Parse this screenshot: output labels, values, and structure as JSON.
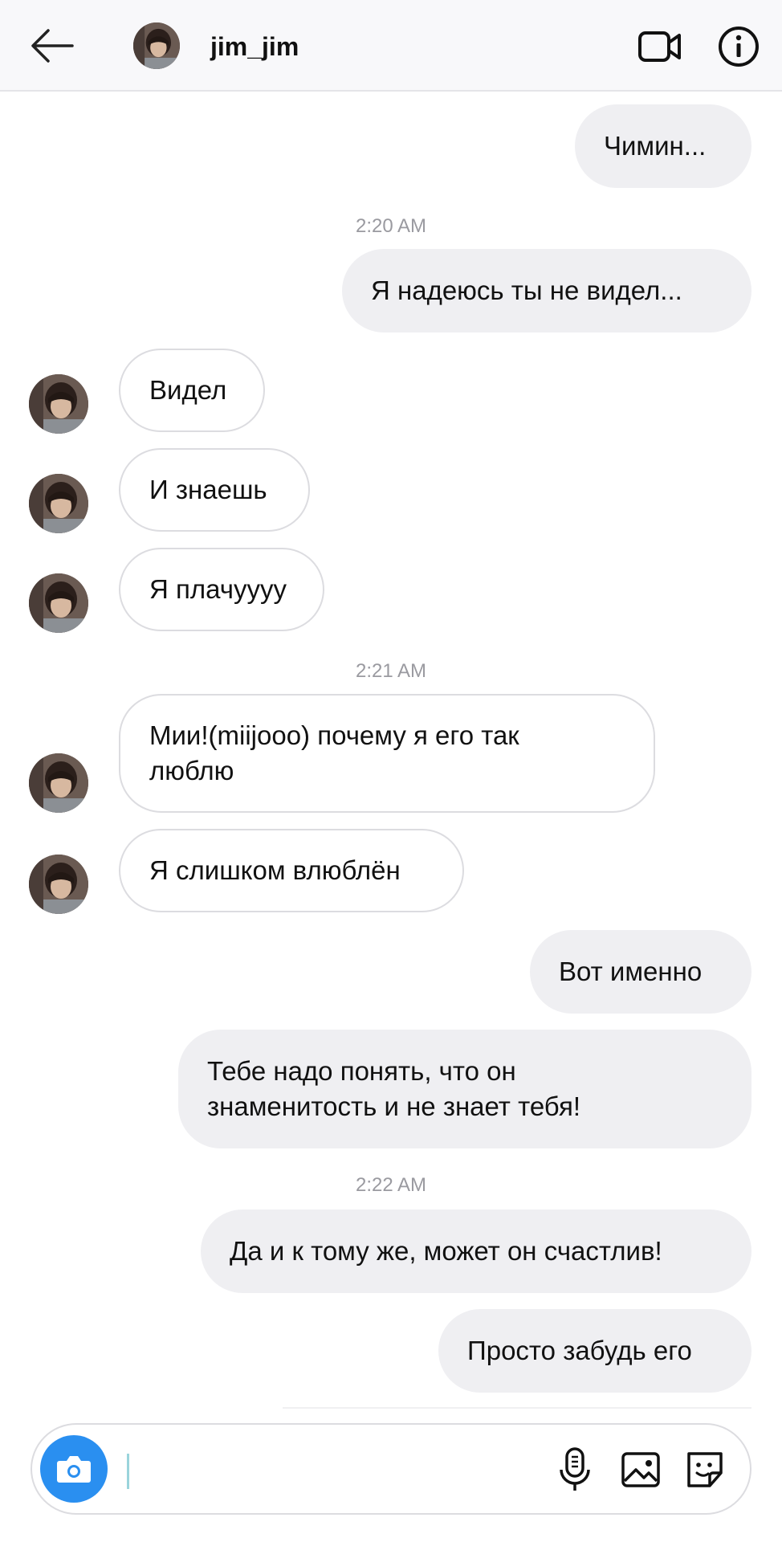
{
  "header": {
    "username": "jim_jim",
    "icons": {
      "back": "arrow-left-icon",
      "video": "video-camera-icon",
      "info": "info-icon"
    }
  },
  "timestamps": [
    "2:20 AM",
    "2:21 AM",
    "2:22 AM"
  ],
  "messages": [
    {
      "direction": "outgoing",
      "text": "Чимин..."
    },
    {
      "direction": "outgoing",
      "text": "Я надеюсь ты не видел..."
    },
    {
      "direction": "incoming",
      "text": "Видел"
    },
    {
      "direction": "incoming",
      "text": "И знаешь"
    },
    {
      "direction": "incoming",
      "text": "Я плачуууу"
    },
    {
      "direction": "incoming",
      "line1": "Мии!(miijooo) почему я его так",
      "line2": "люблю"
    },
    {
      "direction": "incoming",
      "text": "Я слишком влюблён"
    },
    {
      "direction": "outgoing",
      "text": "Вот именно"
    },
    {
      "direction": "outgoing",
      "line1": "Тебе надо понять, что он",
      "line2": "знаменитость и не знает тебя!"
    },
    {
      "direction": "outgoing",
      "text": "Да и к тому же, может он счастлив!"
    },
    {
      "direction": "outgoing",
      "text": "Просто забудь его"
    }
  ],
  "composer": {
    "placeholder": "",
    "icons": [
      "camera-icon",
      "microphone-icon",
      "gallery-icon",
      "sticker-icon"
    ]
  },
  "colors": {
    "accent": "#2a8ff0",
    "outgoing_bubble": "#efeff2",
    "incoming_border": "#dcdce0"
  }
}
